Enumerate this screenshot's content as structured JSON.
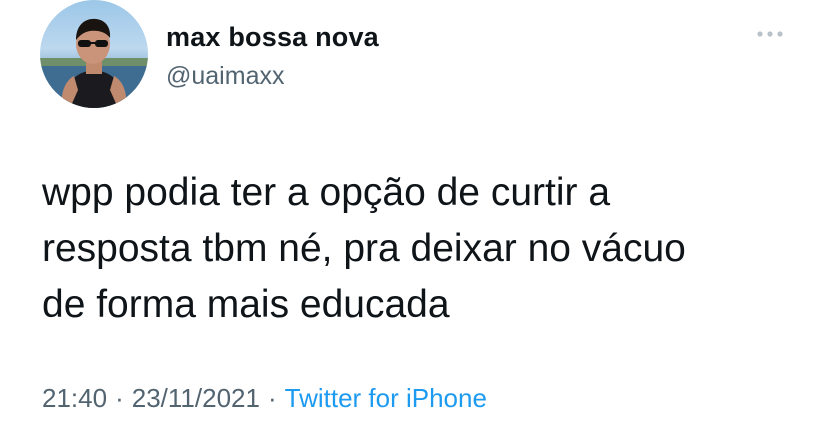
{
  "user": {
    "display_name": "max bossa nova",
    "handle": "@uaimaxx",
    "avatar_icon": "profile-photo"
  },
  "tweet": {
    "lines": [
      "wpp podia ter a opção de curtir a",
      "resposta tbm né, pra deixar no vácuo",
      "de forma mais educada"
    ]
  },
  "meta": {
    "time": "21:40",
    "separator": "·",
    "date": "23/11/2021",
    "source": "Twitter for iPhone"
  },
  "more_icon": "more-horizontal-icon",
  "colors": {
    "text": "#0f1419",
    "secondary": "#536471",
    "link": "#1d9bf0"
  }
}
